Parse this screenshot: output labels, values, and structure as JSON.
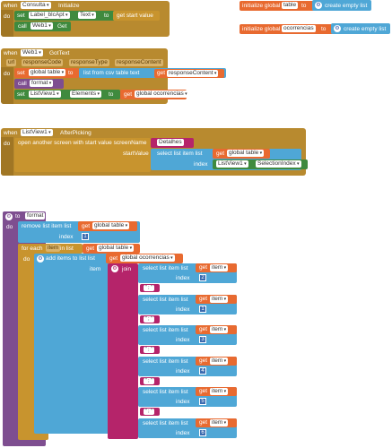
{
  "block1": {
    "when": "when",
    "component": "Consulta",
    "event": "Initialize",
    "do": "do",
    "set": "set",
    "target": "Label_blcApt",
    "prop": "Text",
    "to": "to",
    "get_start": "get start value",
    "call": "call",
    "call_comp": "Web1",
    "call_method": "Get"
  },
  "init1": {
    "label": "initialize global",
    "name": "table",
    "to": "to",
    "value": "create empty list"
  },
  "init2": {
    "label": "initialize global",
    "name": "ocorrencias",
    "to": "to",
    "value": "create empty list"
  },
  "block2": {
    "when": "when",
    "component": "Web1",
    "event": "GotText",
    "params": [
      "url",
      "responseCode",
      "responseType",
      "responseContent"
    ],
    "do": "do",
    "set1": "set",
    "var1": "global table",
    "to1": "to",
    "csv": "list from csv table  text",
    "get_rc": "get",
    "rc_name": "responseContent",
    "call": "call",
    "call_name": "format",
    "set2": "set",
    "target2": "ListView1",
    "prop2": "Elements",
    "to2": "to",
    "get_oc": "get",
    "oc_name": "global ocorrencias"
  },
  "block3": {
    "when": "when",
    "component": "ListView1",
    "event": "AfterPicking",
    "do": "do",
    "open": "open another screen with start value  screenName",
    "screen": "Detalhes",
    "startValue": "startValue",
    "select": "select list item  list",
    "get_table": "get",
    "table_name": "global table",
    "index": "index",
    "lv": "ListView1",
    "lv_prop": "SelectionIndex"
  },
  "block4": {
    "to": "to",
    "proc": "format",
    "do": "do",
    "remove": "remove list item  list",
    "get_t": "get",
    "t_name": "global table",
    "index": "index",
    "index_val": "1",
    "foreach": "for each",
    "item": "item",
    "in_list": "in list",
    "get_t2": "get",
    "t2_name": "global table",
    "do2": "do",
    "add": "add items to list  list",
    "get_oc": "get",
    "oc_name": "global ocorrencias",
    "item_label": "item",
    "join": "join",
    "rows": [
      {
        "select": "select list item  list",
        "get": "get",
        "var": "item",
        "index": "index",
        "idx": "2",
        "sep": " \" ; \" "
      },
      {
        "select": "select list item  list",
        "get": "get",
        "var": "item",
        "index": "index",
        "idx": "1",
        "sep": " \" ; \" "
      },
      {
        "select": "select list item  list",
        "get": "get",
        "var": "item",
        "index": "index",
        "idx": "3",
        "sep": " \" ; \" "
      },
      {
        "select": "select list item  list",
        "get": "get",
        "var": "item",
        "index": "index",
        "idx": "4",
        "sep": " \" ; \" "
      },
      {
        "select": "select list item  list",
        "get": "get",
        "var": "item",
        "index": "index",
        "idx": "5",
        "sep": " \" ; \" "
      },
      {
        "select": "select list item  list",
        "get": "get",
        "var": "item",
        "index": "index",
        "idx": "6",
        "sep": ""
      }
    ]
  }
}
